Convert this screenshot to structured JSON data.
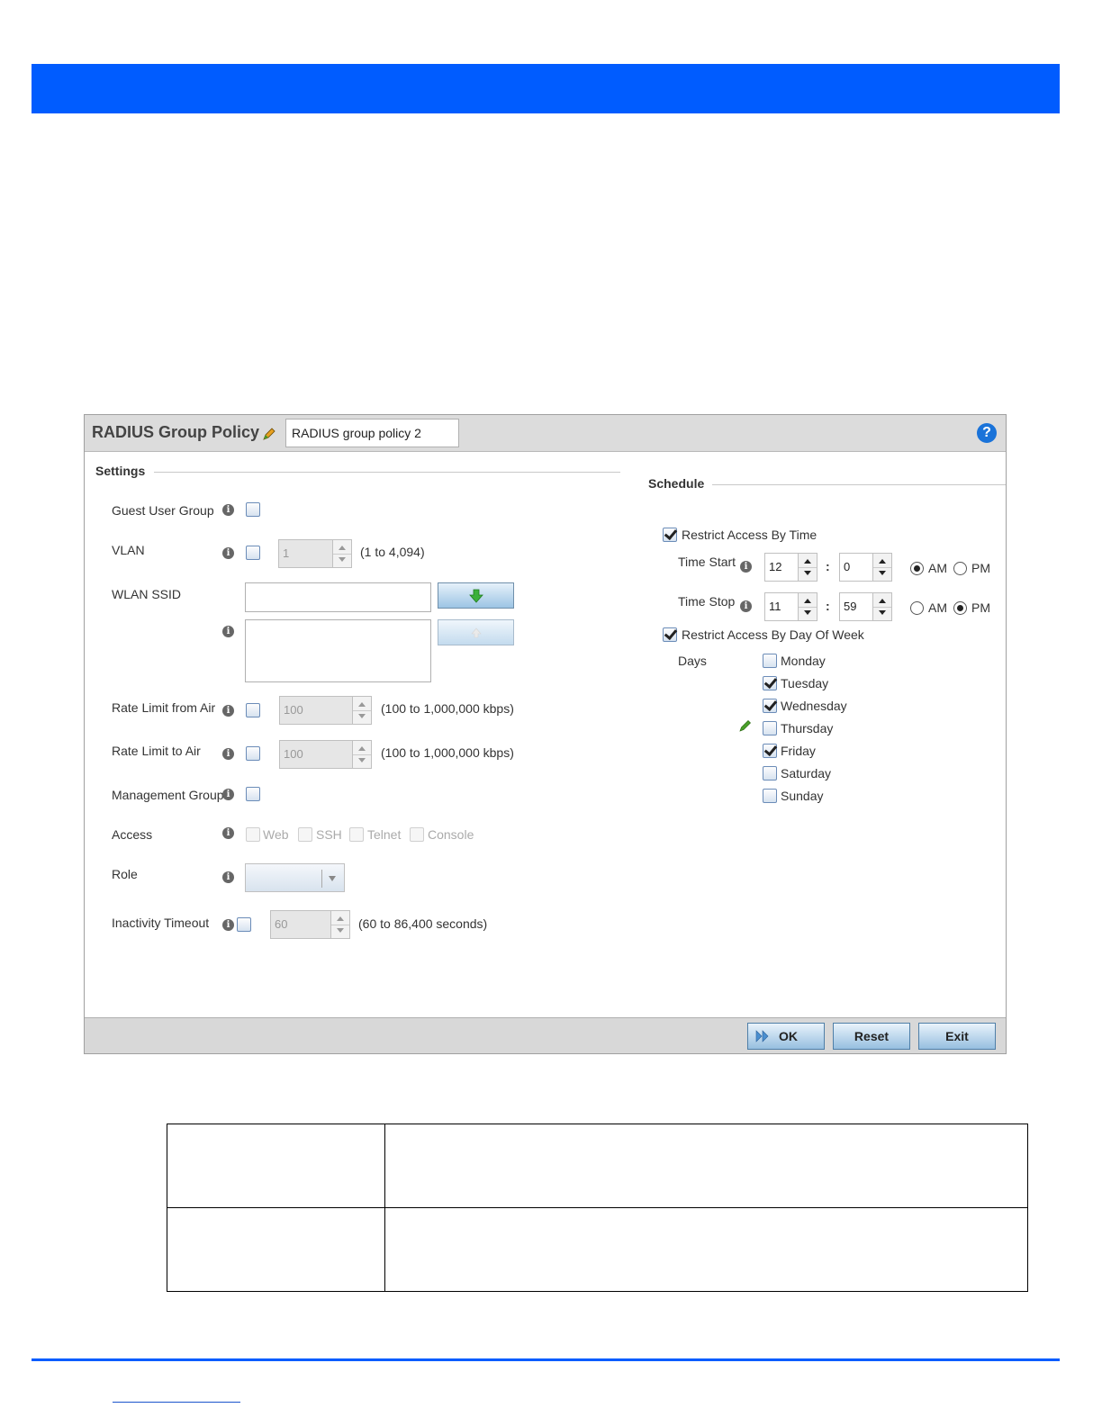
{
  "dialog": {
    "title": "RADIUS Group Policy",
    "name_value": "RADIUS group policy 2",
    "help_glyph": "?"
  },
  "settings": {
    "section_label": "Settings",
    "guest_user_group": {
      "label": "Guest User Group",
      "checked": false
    },
    "vlan": {
      "label": "VLAN",
      "value": "1",
      "hint": "(1 to 4,094)",
      "checked": false
    },
    "wlan_ssid": {
      "label": "WLAN SSID",
      "value": ""
    },
    "rate_limit_from_air": {
      "label": "Rate Limit from Air",
      "value": "100",
      "hint": "(100 to 1,000,000 kbps)"
    },
    "rate_limit_to_air": {
      "label": "Rate Limit to Air",
      "value": "100",
      "hint": "(100 to 1,000,000 kbps)"
    },
    "management_group": {
      "label": "Management Group"
    },
    "access": {
      "label": "Access",
      "options": [
        "Web",
        "SSH",
        "Telnet",
        "Console"
      ]
    },
    "role": {
      "label": "Role",
      "value": ""
    },
    "inactivity_timeout": {
      "label": "Inactivity Timeout",
      "value": "60",
      "hint": "(60 to 86,400 seconds)"
    }
  },
  "schedule": {
    "section_label": "Schedule",
    "restrict_by_time": {
      "label": "Restrict Access By Time",
      "checked": true
    },
    "time_start": {
      "label": "Time Start",
      "hour": "12",
      "minute": "0",
      "period": "AM"
    },
    "time_stop": {
      "label": "Time Stop",
      "hour": "11",
      "minute": "59",
      "period": "PM"
    },
    "colon": ":",
    "am_label": "AM",
    "pm_label": "PM",
    "restrict_by_day": {
      "label": "Restrict Access By Day Of Week",
      "checked": true
    },
    "days_label": "Days",
    "days": [
      {
        "name": "Monday",
        "checked": false
      },
      {
        "name": "Tuesday",
        "checked": true
      },
      {
        "name": "Wednesday",
        "checked": true
      },
      {
        "name": "Thursday",
        "checked": false
      },
      {
        "name": "Friday",
        "checked": true
      },
      {
        "name": "Saturday",
        "checked": false
      },
      {
        "name": "Sunday",
        "checked": false
      }
    ]
  },
  "footer": {
    "ok_label": "OK",
    "reset_label": "Reset",
    "exit_label": "Exit"
  },
  "icons": {
    "edit": "pencil-icon",
    "info": "info-icon",
    "help": "help-icon",
    "move_down": "green-down-arrow-icon",
    "ok": "double-arrow-icon"
  },
  "colors": {
    "banner": "#005cff",
    "footer_bar": "#d8d8d8",
    "help_icon": "#1a73d9"
  }
}
